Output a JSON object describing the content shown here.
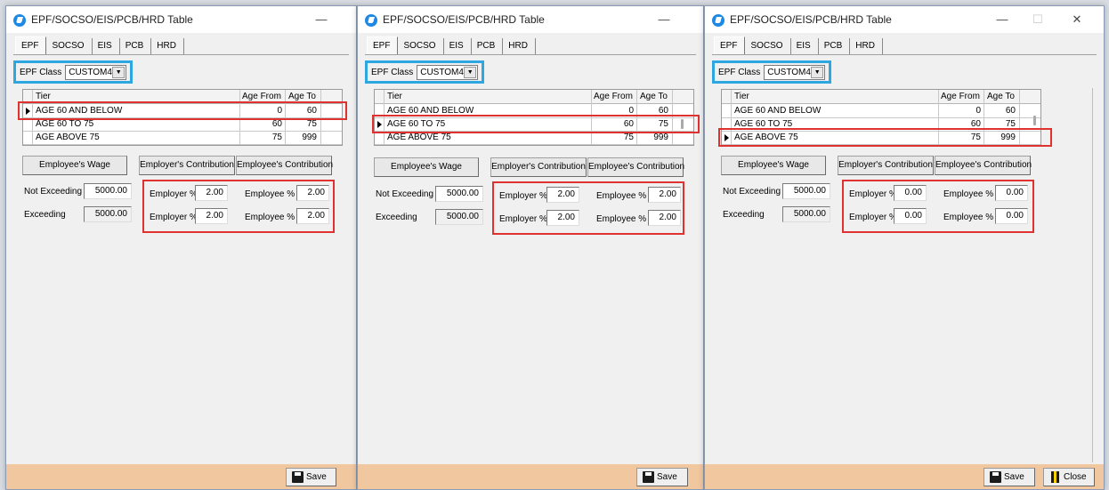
{
  "window": {
    "title": "EPF/SOCSO/EIS/PCB/HRD Table",
    "controls": {
      "minimize": "—",
      "maximize": "☐",
      "close": "✕"
    }
  },
  "tabs": [
    "EPF",
    "SOCSO",
    "EIS",
    "PCB",
    "HRD"
  ],
  "epf_class": {
    "label": "EPF Class",
    "value": "CUSTOM4"
  },
  "grid": {
    "headers": {
      "tier": "Tier",
      "age_from": "Age From",
      "age_to": "Age To"
    },
    "rows": [
      {
        "tier": "AGE 60 AND BELOW",
        "age_from": "0",
        "age_to": "60"
      },
      {
        "tier": "AGE 60 TO 75",
        "age_from": "60",
        "age_to": "75"
      },
      {
        "tier": "AGE ABOVE 75",
        "age_from": "75",
        "age_to": "999"
      }
    ]
  },
  "buttons": {
    "employee_wage": "Employee's Wage",
    "employer_contribution": "Employer's Contribution",
    "employee_contribution": "Employee's Contribution"
  },
  "labels": {
    "not_exceeding": "Not Exceeding",
    "exceeding": "Exceeding",
    "employer_pct": "Employer %",
    "employee_pct": "Employee %"
  },
  "footer": {
    "save": "Save",
    "close": "Close"
  },
  "windows": [
    {
      "selected_row": "AGE 60 AND BELOW",
      "wage": {
        "not_exceeding": "5000.00",
        "exceeding": "5000.00"
      },
      "contrib": {
        "row1_employer": "2.00",
        "row1_employee": "2.00",
        "row2_employer": "2.00",
        "row2_employee": "2.00"
      }
    },
    {
      "selected_row": "AGE 60 TO 75",
      "wage": {
        "not_exceeding": "5000.00",
        "exceeding": "5000.00"
      },
      "contrib": {
        "row1_employer": "2.00",
        "row1_employee": "2.00",
        "row2_employer": "2.00",
        "row2_employee": "2.00"
      }
    },
    {
      "selected_row": "AGE ABOVE 75",
      "wage": {
        "not_exceeding": "5000.00",
        "exceeding": "5000.00"
      },
      "contrib": {
        "row1_employer": "0.00",
        "row1_employee": "0.00",
        "row2_employer": "0.00",
        "row2_employee": "0.00"
      }
    }
  ],
  "colors": {
    "blue_highlight": "#2ea7e0",
    "red_highlight": "#e03131",
    "footer_bar": "#f1c7a0"
  }
}
